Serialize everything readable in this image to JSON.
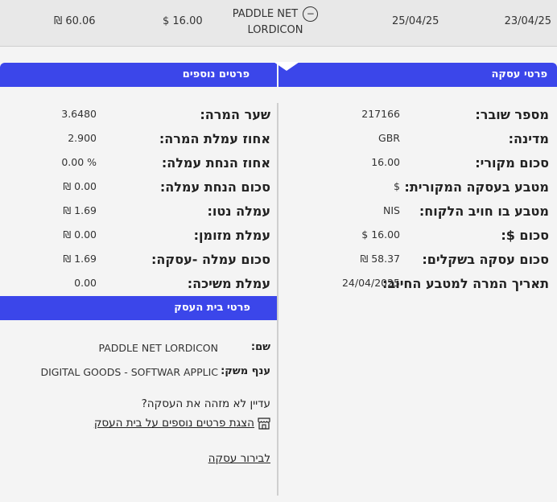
{
  "transaction_row": {
    "date_1": "23/04/25",
    "date_2": "25/04/25",
    "merchant_line1": "PADDLE NET",
    "merchant_line2": "LORDICON",
    "amount_usd": "$ 16.00",
    "amount_nis": "₪ 60.06"
  },
  "tabs": {
    "transaction_details": "פרטי עסקה",
    "more_details": "פרטים נוספים"
  },
  "transaction_details": [
    {
      "label": "מספר שובר:",
      "value": "217166"
    },
    {
      "label": "מדינה:",
      "value": "GBR"
    },
    {
      "label": "סכום מקורי:",
      "value": "16.00"
    },
    {
      "label": "מטבע בעסקה המקורית:",
      "value": "$"
    },
    {
      "label": "מטבע בו חויב הלקוח:",
      "value": "NIS"
    },
    {
      "label": "סכום $:",
      "value": "$ 16.00"
    },
    {
      "label": "סכום עסקה בשקלים:",
      "value": "₪ 58.37"
    },
    {
      "label": "תאריך המרה למטבע החיוב:",
      "value": "24/04/2025"
    }
  ],
  "more_details": [
    {
      "label": "שער המרה:",
      "value": "3.6480"
    },
    {
      "label": "אחוז עמלת המרה:",
      "value": "2.900"
    },
    {
      "label": "אחוז הנחת עמלה:",
      "value": "0.00 %"
    },
    {
      "label": "סכום הנחת עמלה:",
      "value": "₪ 0.00"
    },
    {
      "label": "עמלה נטו:",
      "value": "₪ 1.69"
    },
    {
      "label": "עמלת מזומן:",
      "value": "₪ 0.00"
    },
    {
      "label": "סכום עמלה -עסקה:",
      "value": "₪ 1.69"
    },
    {
      "label": "עמלת משיכה:",
      "value": "0.00"
    }
  ],
  "business": {
    "header": "פרטי בית העסק",
    "name_label": "שם:",
    "name_value": "PADDLE NET LORDICON",
    "sector_label": "ענף משק:",
    "sector_value": "DIGITAL GOODS - SOFTWAR APPLIC",
    "question": "עדיין לא מזהה את העסקה?",
    "more_link": "הצגת פרטים נוספים על בית העסק",
    "clarify_link": "לבירור עסקה"
  },
  "icons": {
    "minus": "−",
    "store": "store-icon"
  },
  "colors": {
    "accent": "#3b46ea"
  }
}
